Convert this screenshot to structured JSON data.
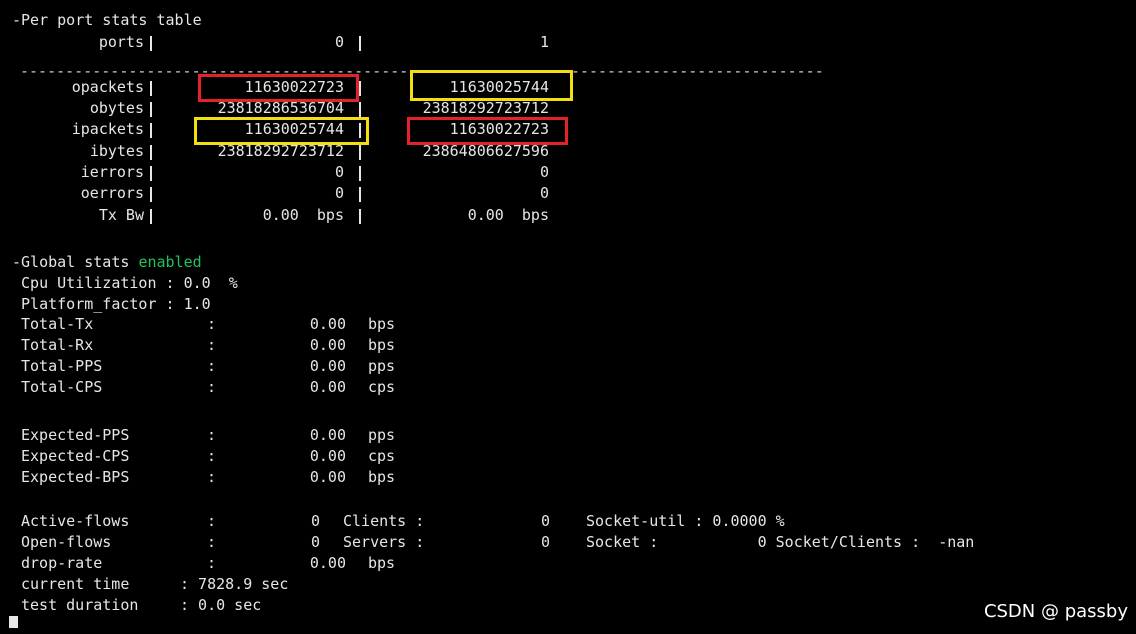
{
  "window": {
    "watermark": "CSDN @ passby"
  },
  "colors": {
    "background": "#000000",
    "text": "#e6e6e6",
    "enabled": "#1fc35c",
    "highlight_red": "#e3222a",
    "highlight_yellow": "#f3de0f"
  },
  "port_stats": {
    "heading": "-Per port stats table",
    "header_label": "ports",
    "port_ids": [
      "0",
      "1"
    ],
    "separator": "-----------------------------------------------------------------------------------------",
    "rows": [
      {
        "label": "opackets",
        "p0": "11630022723",
        "p1": "11630025744"
      },
      {
        "label": "obytes",
        "p0": "23818286536704",
        "p1": "23818292723712"
      },
      {
        "label": "ipackets",
        "p0": "11630025744",
        "p1": "11630022723"
      },
      {
        "label": "ibytes",
        "p0": "23818292723712",
        "p1": "23864806627596"
      },
      {
        "label": "ierrors",
        "p0": "0",
        "p1": "0"
      },
      {
        "label": "oerrors",
        "p0": "0",
        "p1": "0"
      },
      {
        "label": "Tx Bw",
        "p0": "0.00  bps",
        "p1": "0.00  bps"
      }
    ]
  },
  "global_stats": {
    "heading": "-Global stats ",
    "status": "enabled",
    "cpu_line": " Cpu Utilization : 0.0  %",
    "platform_line": " Platform_factor : 1.0",
    "rates": [
      {
        "label": "Total-Tx",
        "value": "0.00",
        "unit": "bps"
      },
      {
        "label": "Total-Rx",
        "value": "0.00",
        "unit": "bps"
      },
      {
        "label": "Total-PPS",
        "value": "0.00",
        "unit": "pps"
      },
      {
        "label": "Total-CPS",
        "value": "0.00",
        "unit": "cps"
      }
    ],
    "expected": [
      {
        "label": "Expected-PPS",
        "value": "0.00",
        "unit": "pps"
      },
      {
        "label": "Expected-CPS",
        "value": "0.00",
        "unit": "cps"
      },
      {
        "label": "Expected-BPS",
        "value": "0.00",
        "unit": "bps"
      }
    ],
    "active_flows": {
      "label": "Active-flows",
      "value": "0",
      "key": "Clients :",
      "key_value": "0",
      "extra": "Socket-util : 0.0000 %"
    },
    "open_flows": {
      "label": "Open-flows",
      "value": "0",
      "key": "Servers :",
      "key_value": "0",
      "extra": "Socket :           0 Socket/Clients :  -nan"
    },
    "drop_rate": {
      "label": "drop-rate",
      "value": "0.00",
      "unit": "bps"
    },
    "current_time": {
      "label": "current time",
      "value": ": 7828.9 sec"
    },
    "test_duration": {
      "label": "test duration",
      "value": ": 0.0 sec"
    }
  }
}
